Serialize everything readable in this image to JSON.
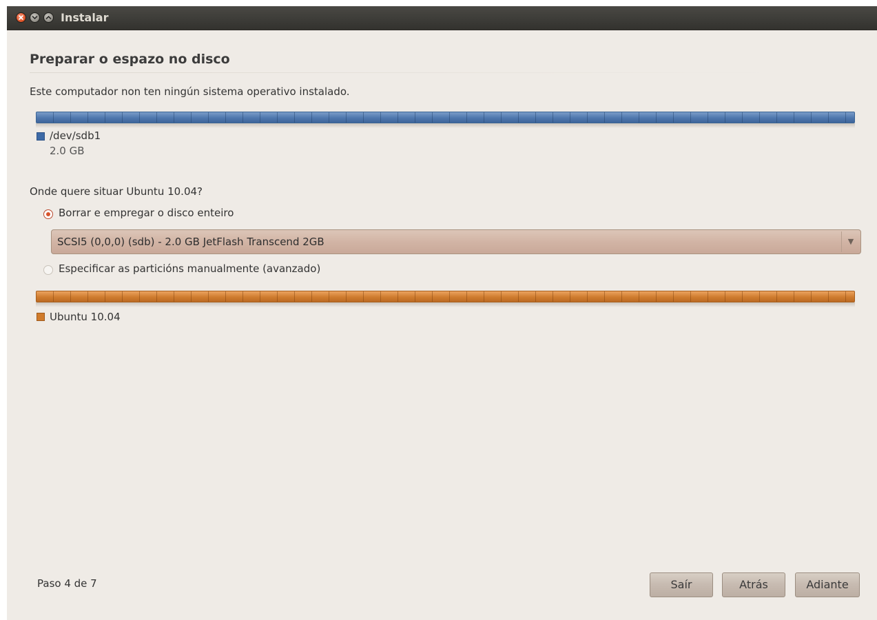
{
  "window": {
    "title": "Instalar",
    "close_icon": "close-icon",
    "minimize_icon": "minimize-icon",
    "maximize_icon": "maximize-icon"
  },
  "page": {
    "heading": "Preparar o espazo no disco",
    "intro": "Este computador non ten ningún sistema operativo instalado."
  },
  "current_disk": {
    "partition_name": "/dev/sdb1",
    "partition_size": "2.0 GB",
    "color": "#3e6aa6"
  },
  "question": "Onde quere situar Ubuntu 10.04?",
  "options": {
    "erase_label": "Borrar e empregar o disco enteiro",
    "erase_selected": true,
    "disk_select_value": "SCSI5 (0,0,0) (sdb) - 2.0 GB JetFlash Transcend 2GB",
    "manual_label": "Especificar as particións manualmente (avanzado)",
    "manual_selected": false
  },
  "new_layout": {
    "label": "Ubuntu 10.04",
    "color": "#d07b2c"
  },
  "footer": {
    "step": "Paso 4 de 7",
    "quit_label": "Saír",
    "back_label": "Atrás",
    "forward_label": "Adiante"
  }
}
